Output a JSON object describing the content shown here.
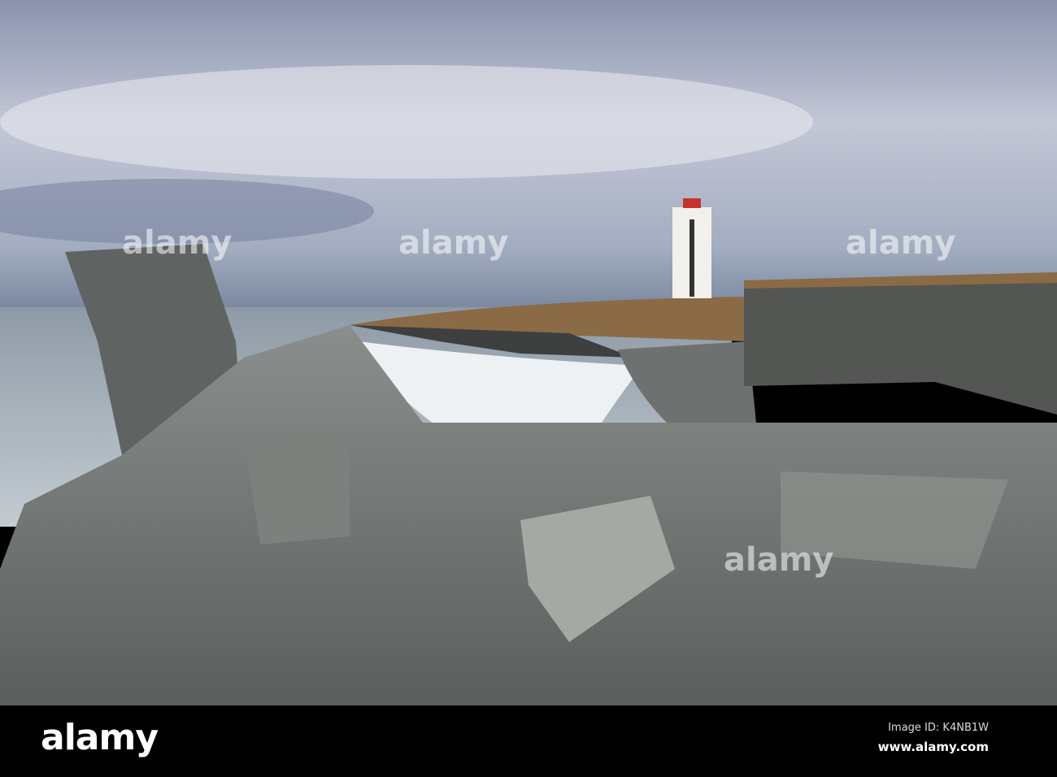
{
  "watermark": {
    "brand": "alamy"
  },
  "footer": {
    "logo": "alamy",
    "image_id": "Image ID: K4NB1W",
    "url": "www.alamy.com"
  }
}
